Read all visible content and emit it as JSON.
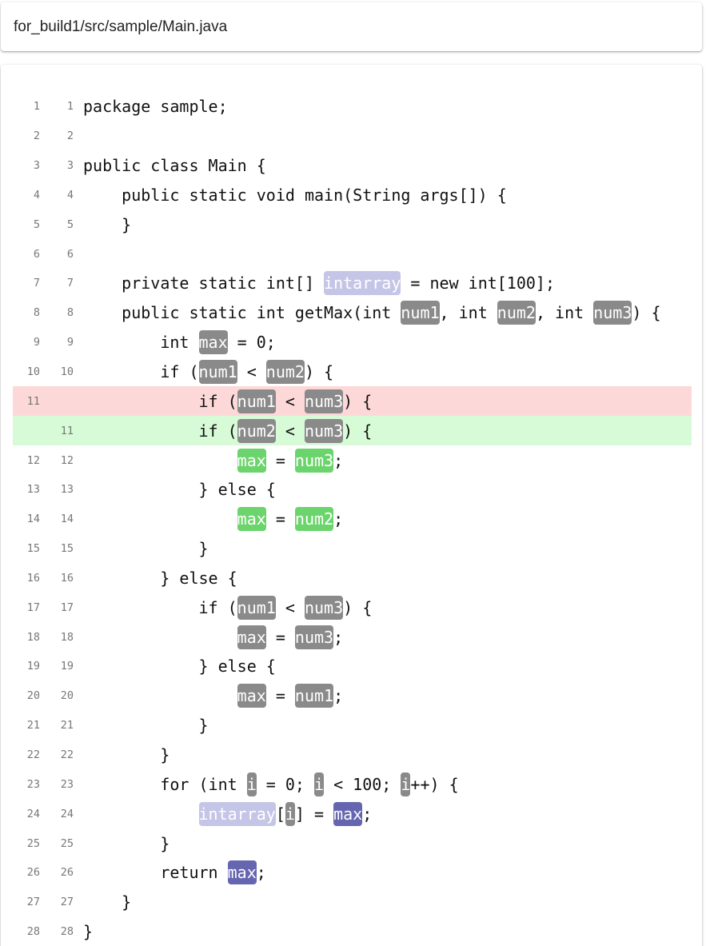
{
  "header": {
    "file_path": "for_build1/src/sample/Main.java"
  },
  "highlight_colors": {
    "gray": "#8a8a8a",
    "green": "#6cd46c",
    "lavender": "#c5c5e8",
    "purple": "#6666b0",
    "removed_line_bg": "#fdd8d8",
    "added_line_bg": "#d6fbd6"
  },
  "diff_lines": [
    {
      "old": "1",
      "new": "1",
      "kind": "context",
      "tokens": [
        {
          "t": "package sample;"
        }
      ]
    },
    {
      "old": "2",
      "new": "2",
      "kind": "context",
      "tokens": []
    },
    {
      "old": "3",
      "new": "3",
      "kind": "context",
      "tokens": [
        {
          "t": "public class Main {"
        }
      ]
    },
    {
      "old": "4",
      "new": "4",
      "kind": "context",
      "tokens": [
        {
          "t": "    public static void main(String args[]) {"
        }
      ]
    },
    {
      "old": "5",
      "new": "5",
      "kind": "context",
      "tokens": [
        {
          "t": "    }"
        }
      ]
    },
    {
      "old": "6",
      "new": "6",
      "kind": "context",
      "tokens": []
    },
    {
      "old": "7",
      "new": "7",
      "kind": "context",
      "tokens": [
        {
          "t": "    private static int[] "
        },
        {
          "t": "intarray",
          "hl": "lavender"
        },
        {
          "t": " = new int[100];"
        }
      ]
    },
    {
      "old": "8",
      "new": "8",
      "kind": "context",
      "tokens": [
        {
          "t": "    public static int getMax(int "
        },
        {
          "t": "num1",
          "hl": "gray"
        },
        {
          "t": ", int "
        },
        {
          "t": "num2",
          "hl": "gray"
        },
        {
          "t": ", int "
        },
        {
          "t": "num3",
          "hl": "gray"
        },
        {
          "t": ") {"
        }
      ]
    },
    {
      "old": "9",
      "new": "9",
      "kind": "context",
      "tokens": [
        {
          "t": "        int "
        },
        {
          "t": "max",
          "hl": "gray"
        },
        {
          "t": " = 0;"
        }
      ]
    },
    {
      "old": "10",
      "new": "10",
      "kind": "context",
      "tokens": [
        {
          "t": "        if ("
        },
        {
          "t": "num1",
          "hl": "gray"
        },
        {
          "t": " < "
        },
        {
          "t": "num2",
          "hl": "gray"
        },
        {
          "t": ") {"
        }
      ]
    },
    {
      "old": "11",
      "new": "",
      "kind": "removed",
      "tokens": [
        {
          "t": "            if ("
        },
        {
          "t": "num1",
          "hl": "gray"
        },
        {
          "t": " < "
        },
        {
          "t": "num3",
          "hl": "gray"
        },
        {
          "t": ") {"
        }
      ]
    },
    {
      "old": "",
      "new": "11",
      "kind": "added",
      "tokens": [
        {
          "t": "            if ("
        },
        {
          "t": "num2",
          "hl": "gray"
        },
        {
          "t": " < "
        },
        {
          "t": "num3",
          "hl": "gray"
        },
        {
          "t": ") {"
        }
      ]
    },
    {
      "old": "12",
      "new": "12",
      "kind": "context",
      "tokens": [
        {
          "t": "                "
        },
        {
          "t": "max",
          "hl": "green"
        },
        {
          "t": " = "
        },
        {
          "t": "num3",
          "hl": "green"
        },
        {
          "t": ";"
        }
      ]
    },
    {
      "old": "13",
      "new": "13",
      "kind": "context",
      "tokens": [
        {
          "t": "            } else {"
        }
      ]
    },
    {
      "old": "14",
      "new": "14",
      "kind": "context",
      "tokens": [
        {
          "t": "                "
        },
        {
          "t": "max",
          "hl": "green"
        },
        {
          "t": " = "
        },
        {
          "t": "num2",
          "hl": "green"
        },
        {
          "t": ";"
        }
      ]
    },
    {
      "old": "15",
      "new": "15",
      "kind": "context",
      "tokens": [
        {
          "t": "            }"
        }
      ]
    },
    {
      "old": "16",
      "new": "16",
      "kind": "context",
      "tokens": [
        {
          "t": "        } else {"
        }
      ]
    },
    {
      "old": "17",
      "new": "17",
      "kind": "context",
      "tokens": [
        {
          "t": "            if ("
        },
        {
          "t": "num1",
          "hl": "gray"
        },
        {
          "t": " < "
        },
        {
          "t": "num3",
          "hl": "gray"
        },
        {
          "t": ") {"
        }
      ]
    },
    {
      "old": "18",
      "new": "18",
      "kind": "context",
      "tokens": [
        {
          "t": "                "
        },
        {
          "t": "max",
          "hl": "gray"
        },
        {
          "t": " = "
        },
        {
          "t": "num3",
          "hl": "gray"
        },
        {
          "t": ";"
        }
      ]
    },
    {
      "old": "19",
      "new": "19",
      "kind": "context",
      "tokens": [
        {
          "t": "            } else {"
        }
      ]
    },
    {
      "old": "20",
      "new": "20",
      "kind": "context",
      "tokens": [
        {
          "t": "                "
        },
        {
          "t": "max",
          "hl": "gray"
        },
        {
          "t": " = "
        },
        {
          "t": "num1",
          "hl": "gray"
        },
        {
          "t": ";"
        }
      ]
    },
    {
      "old": "21",
      "new": "21",
      "kind": "context",
      "tokens": [
        {
          "t": "            }"
        }
      ]
    },
    {
      "old": "22",
      "new": "22",
      "kind": "context",
      "tokens": [
        {
          "t": "        }"
        }
      ]
    },
    {
      "old": "23",
      "new": "23",
      "kind": "context",
      "tokens": [
        {
          "t": "        for (int "
        },
        {
          "t": "i",
          "hl": "gray"
        },
        {
          "t": " = 0; "
        },
        {
          "t": "i",
          "hl": "gray"
        },
        {
          "t": " < 100; "
        },
        {
          "t": "i",
          "hl": "gray"
        },
        {
          "t": "++) {"
        }
      ]
    },
    {
      "old": "24",
      "new": "24",
      "kind": "context",
      "tokens": [
        {
          "t": "            "
        },
        {
          "t": "intarray",
          "hl": "lavender"
        },
        {
          "t": "["
        },
        {
          "t": "i",
          "hl": "gray"
        },
        {
          "t": "] = "
        },
        {
          "t": "max",
          "hl": "purple"
        },
        {
          "t": ";"
        }
      ]
    },
    {
      "old": "25",
      "new": "25",
      "kind": "context",
      "tokens": [
        {
          "t": "        }"
        }
      ]
    },
    {
      "old": "26",
      "new": "26",
      "kind": "context",
      "tokens": [
        {
          "t": "        return "
        },
        {
          "t": "max",
          "hl": "purple"
        },
        {
          "t": ";"
        }
      ]
    },
    {
      "old": "27",
      "new": "27",
      "kind": "context",
      "tokens": [
        {
          "t": "    }"
        }
      ]
    },
    {
      "old": "28",
      "new": "28",
      "kind": "context",
      "tokens": [
        {
          "t": "}"
        }
      ]
    }
  ]
}
